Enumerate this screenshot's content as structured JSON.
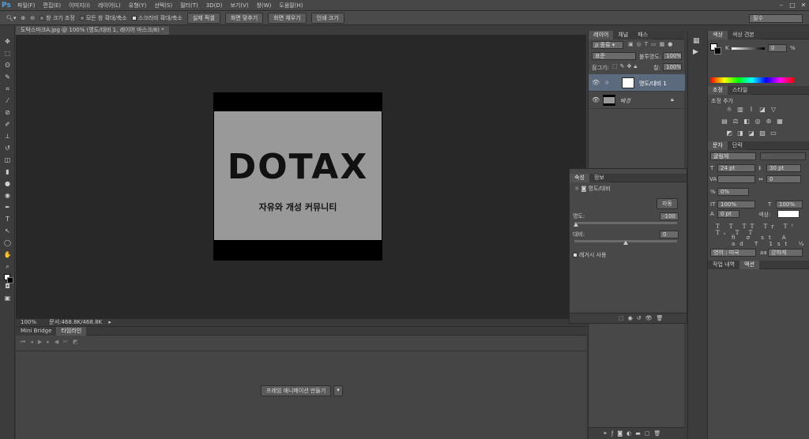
{
  "app": {
    "logo": "Ps"
  },
  "menu": [
    "파일(F)",
    "편집(E)",
    "이미지(I)",
    "레이어(L)",
    "유형(Y)",
    "선택(S)",
    "필터(T)",
    "3D(D)",
    "보기(V)",
    "창(W)",
    "도움말(H)"
  ],
  "options": {
    "resize_label": "창 크기 조정",
    "all_windows_label": "모든 창 확대/축소",
    "scrubby_label": "스크러비 확대/축소",
    "actual_pixels": "실제 픽셀",
    "fit_screen": "화면 맞추기",
    "fill_screen": "화면 채우기",
    "print_size": "인쇄 크기",
    "workspace": "필수"
  },
  "document": {
    "tab_title": "도탁스마크A.jpg @ 100% (명도/대비 1, 레이어 마스크/8) *",
    "art_title": "DOTAX",
    "art_subtitle": "자유와 개성 커뮤니티"
  },
  "status": {
    "zoom": "100%",
    "doc_info": "문서:468.8K/468.8K"
  },
  "bottom": {
    "tabs": [
      "Mini Bridge",
      "타임라인"
    ],
    "create_anim": "프레임 애니메이션 만들기"
  },
  "layers": {
    "tabs": [
      "레이어",
      "채널",
      "패스"
    ],
    "kind": "종류",
    "blend": "표준",
    "opacity_label": "불투명도:",
    "opacity": "100%",
    "lock_label": "잠그기:",
    "fill_label": "칠:",
    "fill": "100%",
    "items": [
      {
        "name": "명도/대비 1"
      },
      {
        "name": "배경"
      }
    ]
  },
  "properties": {
    "tabs": [
      "속성",
      "정보"
    ],
    "title": "명도/대비",
    "auto": "자동",
    "brightness_label": "명도:",
    "brightness": "-100",
    "contrast_label": "대비:",
    "contrast": "0",
    "legacy": "레거시 사용"
  },
  "color": {
    "tabs": [
      "색상",
      "색상 견본"
    ],
    "k_label": "K",
    "k_value": "0",
    "k_unit": "%"
  },
  "adjust": {
    "tabs": [
      "조정",
      "스타일"
    ],
    "add_label": "조정 추가"
  },
  "char": {
    "tabs": [
      "문자",
      "단락"
    ],
    "font": "굴림체",
    "font_style": "-",
    "size": "24 pt",
    "leading": "30 pt",
    "kerning": "",
    "tracking": "0",
    "scale_pct": "0%",
    "vscale": "100%",
    "hscale": "100%",
    "baseline": "0 pt",
    "color_label": "색상:",
    "lang": "영어 : 미국",
    "aa": "강하게"
  },
  "history": {
    "tabs": [
      "작업 내역",
      "액션"
    ]
  }
}
